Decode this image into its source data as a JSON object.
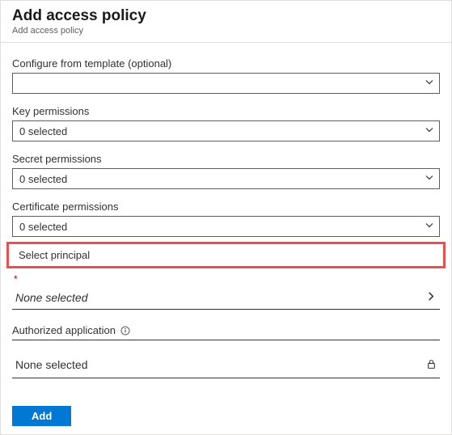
{
  "header": {
    "title": "Add access policy",
    "subtitle": "Add access policy"
  },
  "fields": {
    "template": {
      "label": "Configure from template (optional)",
      "value": ""
    },
    "key": {
      "label": "Key permissions",
      "value": "0 selected"
    },
    "secret": {
      "label": "Secret permissions",
      "value": "0 selected"
    },
    "certificate": {
      "label": "Certificate permissions",
      "value": "0 selected"
    }
  },
  "principal": {
    "section_label": "Select principal",
    "required_marker": "*",
    "value": "None selected"
  },
  "auth_app": {
    "label": "Authorized application",
    "value": "None selected"
  },
  "buttons": {
    "add": "Add"
  }
}
